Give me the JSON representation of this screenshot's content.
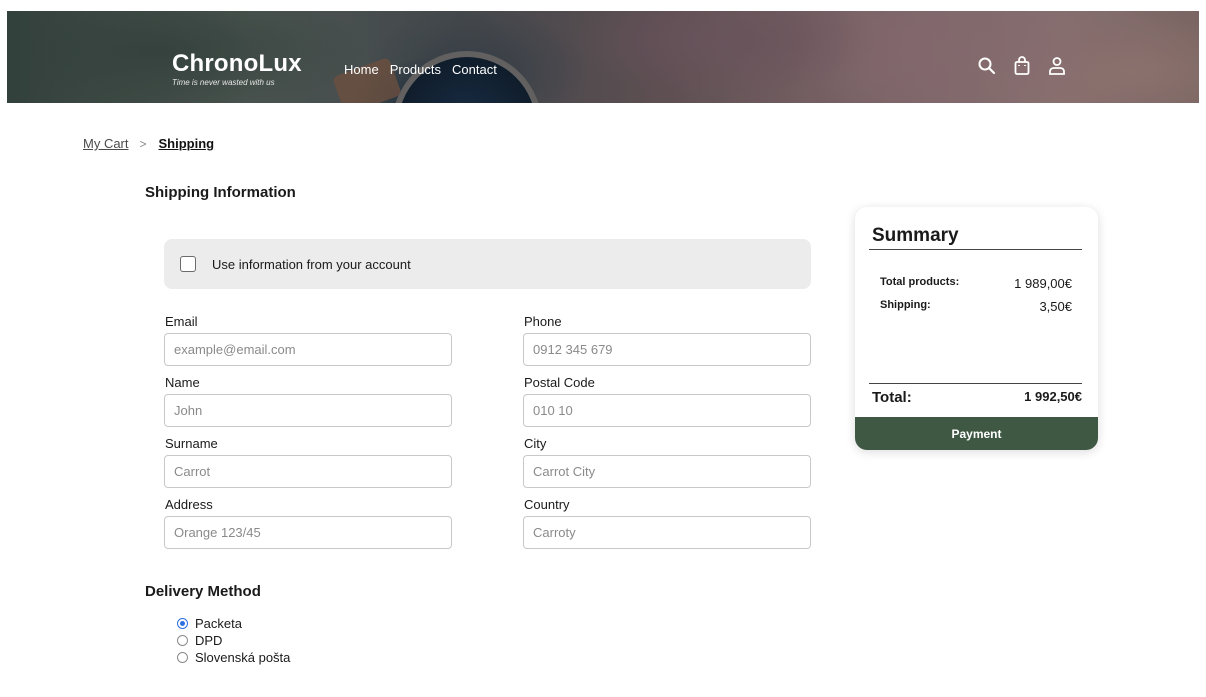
{
  "header": {
    "brand_name": "ChronoLux",
    "tagline": "Time is never wasted with us",
    "nav": [
      "Home",
      "Products",
      "Contact"
    ],
    "icons": [
      "search-icon",
      "shopping-bag-icon",
      "user-icon"
    ]
  },
  "breadcrumb": {
    "parent": "My Cart",
    "separator": ">",
    "current": "Shipping"
  },
  "shipping": {
    "title": "Shipping Information",
    "use_account_label": "Use information from your account",
    "use_account_checked": false,
    "fields": {
      "email": {
        "label": "Email",
        "placeholder": "example@email.com"
      },
      "phone": {
        "label": "Phone",
        "placeholder": "0912 345 679"
      },
      "name": {
        "label": "Name",
        "placeholder": "John"
      },
      "postal_code": {
        "label": "Postal Code",
        "placeholder": "010 10"
      },
      "surname": {
        "label": "Surname",
        "placeholder": "Carrot"
      },
      "city": {
        "label": "City",
        "placeholder": "Carrot City"
      },
      "address": {
        "label": "Address",
        "placeholder": "Orange 123/45"
      },
      "country": {
        "label": "Country",
        "placeholder": "Carroty"
      }
    }
  },
  "delivery": {
    "title": "Delivery Method",
    "options": [
      "Packeta",
      "DPD",
      "Slovenská pošta"
    ],
    "selected": "Packeta"
  },
  "summary": {
    "title": "Summary",
    "total_products_label": "Total products:",
    "total_products_value": "1 989,00€",
    "shipping_label": "Shipping:",
    "shipping_value": "3,50€",
    "total_label": "Total:",
    "total_value": "1 992,50€",
    "payment_button": "Payment"
  },
  "colors": {
    "payment_button": "#3e5844",
    "radio_selected": "#2f6fe0",
    "account_box": "#ececec"
  }
}
